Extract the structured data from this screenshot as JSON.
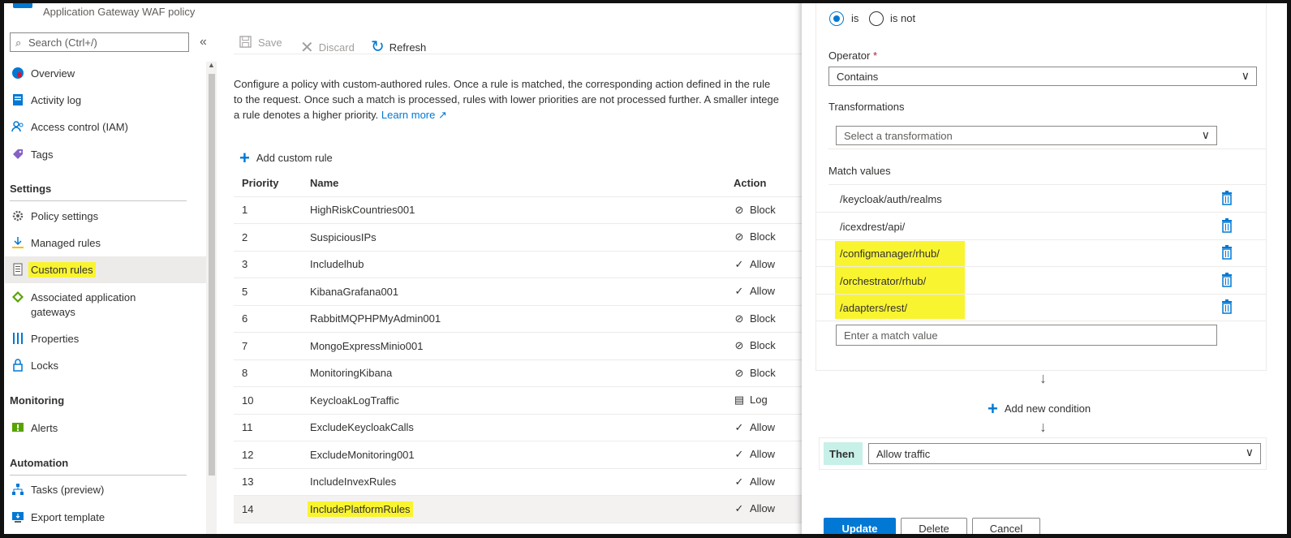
{
  "header": {
    "subtitle": "Application Gateway WAF policy"
  },
  "search": {
    "placeholder": "Search (Ctrl+/)"
  },
  "sidebar": {
    "items": [
      {
        "label": "Overview",
        "icon": "overview-icon"
      },
      {
        "label": "Activity log",
        "icon": "activity-log-icon"
      },
      {
        "label": "Access control (IAM)",
        "icon": "iam-icon"
      },
      {
        "label": "Tags",
        "icon": "tag-icon"
      }
    ],
    "settings_header": "Settings",
    "settings_items": [
      {
        "label": "Policy settings",
        "icon": "gear-icon"
      },
      {
        "label": "Managed rules",
        "icon": "download-icon"
      },
      {
        "label": "Custom rules",
        "icon": "document-icon"
      },
      {
        "label": "Associated application",
        "label2": "gateways",
        "icon": "diamond-icon"
      },
      {
        "label": "Properties",
        "icon": "properties-icon"
      },
      {
        "label": "Locks",
        "icon": "lock-icon"
      }
    ],
    "monitoring_header": "Monitoring",
    "monitoring_items": [
      {
        "label": "Alerts",
        "icon": "alert-icon"
      }
    ],
    "automation_header": "Automation",
    "automation_items": [
      {
        "label": "Tasks (preview)",
        "icon": "tasks-icon"
      },
      {
        "label": "Export template",
        "icon": "export-icon"
      }
    ]
  },
  "toolbar": {
    "save": "Save",
    "discard": "Discard",
    "refresh": "Refresh"
  },
  "description": {
    "line1": "Configure a policy with custom-authored rules. Once a rule is matched, the corresponding action defined in the rule",
    "line2": "to the request. Once such a match is processed, rules with lower priorities are not processed further. A smaller intege",
    "line3": "a rule denotes a higher priority.",
    "learn_more": "Learn more"
  },
  "add_custom_rule": "Add custom rule",
  "table": {
    "columns": [
      "Priority",
      "Name",
      "Action"
    ],
    "rows": [
      {
        "priority": "1",
        "name": "HighRiskCountries001",
        "action": "Block"
      },
      {
        "priority": "2",
        "name": "SuspiciousIPs",
        "action": "Block"
      },
      {
        "priority": "3",
        "name": "Includelhub",
        "action": "Allow"
      },
      {
        "priority": "5",
        "name": "KibanaGrafana001",
        "action": "Allow"
      },
      {
        "priority": "6",
        "name": "RabbitMQPHPMyAdmin001",
        "action": "Block"
      },
      {
        "priority": "7",
        "name": "MongoExpressMinio001",
        "action": "Block"
      },
      {
        "priority": "8",
        "name": "MonitoringKibana",
        "action": "Block"
      },
      {
        "priority": "10",
        "name": "KeycloakLogTraffic",
        "action": "Log"
      },
      {
        "priority": "11",
        "name": "ExcludeKeycloakCalls",
        "action": "Allow"
      },
      {
        "priority": "12",
        "name": "ExcludeMonitoring001",
        "action": "Allow"
      },
      {
        "priority": "13",
        "name": "IncludeInvexRules",
        "action": "Allow"
      },
      {
        "priority": "14",
        "name": "IncludePlatformRules",
        "action": "Allow"
      }
    ]
  },
  "panel": {
    "radio_is": "is",
    "radio_is_not": "is not",
    "operator_label": "Operator",
    "required": "*",
    "operator_value": "Contains",
    "transformations_label": "Transformations",
    "transformation_placeholder": "Select a transformation",
    "match_values_label": "Match values",
    "match_values": [
      "/keycloak/auth/realms",
      "/icexdrest/api/",
      "/configmanager/rhub/",
      "/orchestrator/rhub/",
      "/adapters/rest/"
    ],
    "match_placeholder": "Enter a match value",
    "add_condition": "Add new condition",
    "then_label": "Then",
    "then_value": "Allow traffic",
    "update": "Update",
    "delete": "Delete",
    "cancel": "Cancel"
  },
  "colors": {
    "accent": "#0078d4",
    "highlight": "#f9f430",
    "then_bg": "#c7f0e8"
  }
}
